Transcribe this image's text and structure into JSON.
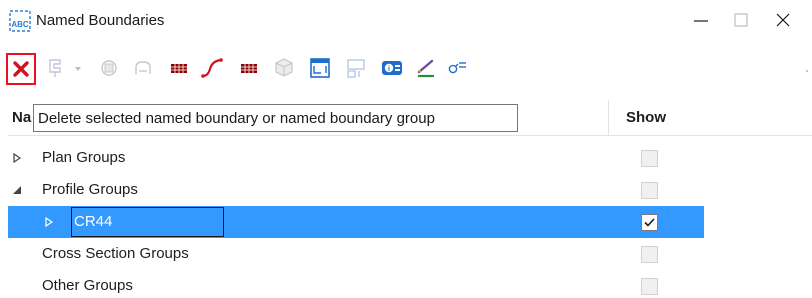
{
  "window": {
    "title": "Named Boundaries",
    "minimize_glyph": "—",
    "close_glyph": "✕"
  },
  "toolbar": {
    "buttons": [
      {
        "name": "delete",
        "icon": "delete-x-icon",
        "enabled": true
      },
      {
        "name": "create-dropdown",
        "icon": "create-boundary-icon",
        "enabled": false
      },
      {
        "name": "group",
        "icon": "group-icon",
        "enabled": false
      },
      {
        "name": "path",
        "icon": "path-icon",
        "enabled": false
      },
      {
        "name": "plan-grid",
        "icon": "grid-icon",
        "enabled": true
      },
      {
        "name": "profile-curve",
        "icon": "curve-icon",
        "enabled": true
      },
      {
        "name": "xs-grid",
        "icon": "grid-icon",
        "enabled": true
      },
      {
        "name": "3d",
        "icon": "cube-icon",
        "enabled": false
      },
      {
        "name": "fit",
        "icon": "fit-view-icon",
        "enabled": true
      },
      {
        "name": "layout",
        "icon": "layout-icon",
        "enabled": false
      },
      {
        "name": "properties",
        "icon": "properties-icon",
        "enabled": true
      },
      {
        "name": "pencil",
        "icon": "pencil-icon",
        "enabled": true
      },
      {
        "name": "filter",
        "icon": "filter-icon",
        "enabled": true
      }
    ],
    "accent_color": "#e81123"
  },
  "tooltip": {
    "text": "Delete selected named boundary or named boundary group"
  },
  "table": {
    "header_name": "Na",
    "header_show": "Show",
    "rows": [
      {
        "label": "Plan Groups",
        "expander": "▷",
        "indent": 0,
        "checked": false,
        "selected": false
      },
      {
        "label": "Profile Groups",
        "expander": "◢",
        "indent": 0,
        "checked": false,
        "selected": false
      },
      {
        "label": "CR44",
        "expander": "▷",
        "indent": 1,
        "checked": true,
        "selected": true
      },
      {
        "label": "Cross Section Groups",
        "expander": "",
        "indent": 0,
        "checked": false,
        "selected": false
      },
      {
        "label": "Other Groups",
        "expander": "",
        "indent": 0,
        "checked": false,
        "selected": false
      }
    ],
    "selection_color": "#3399ff"
  }
}
